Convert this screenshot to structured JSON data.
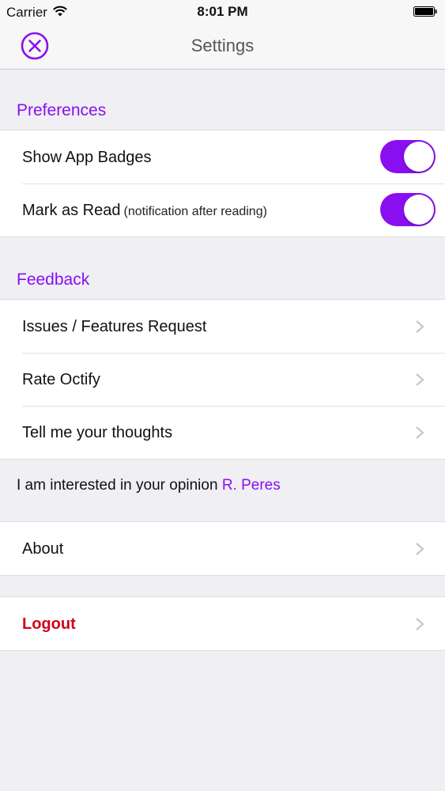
{
  "colors": {
    "accent": "#8a0ff0",
    "logout": "#d0021b"
  },
  "status_bar": {
    "carrier": "Carrier",
    "time": "8:01 PM"
  },
  "nav": {
    "title": "Settings",
    "close_icon": "close-circle-icon"
  },
  "preferences": {
    "header": "Preferences",
    "rows": [
      {
        "label": "Show App Badges",
        "sublabel": "",
        "enabled": true
      },
      {
        "label": "Mark as Read",
        "sublabel": "(notification after reading)",
        "enabled": true
      }
    ]
  },
  "feedback": {
    "header": "Feedback",
    "rows": [
      {
        "label": "Issues / Features Request"
      },
      {
        "label": "Rate Octify"
      },
      {
        "label": "Tell me your thoughts"
      }
    ],
    "note_text": "I am interested in your opinion",
    "note_link": "R. Peres"
  },
  "about": {
    "label": "About"
  },
  "logout": {
    "label": "Logout"
  }
}
